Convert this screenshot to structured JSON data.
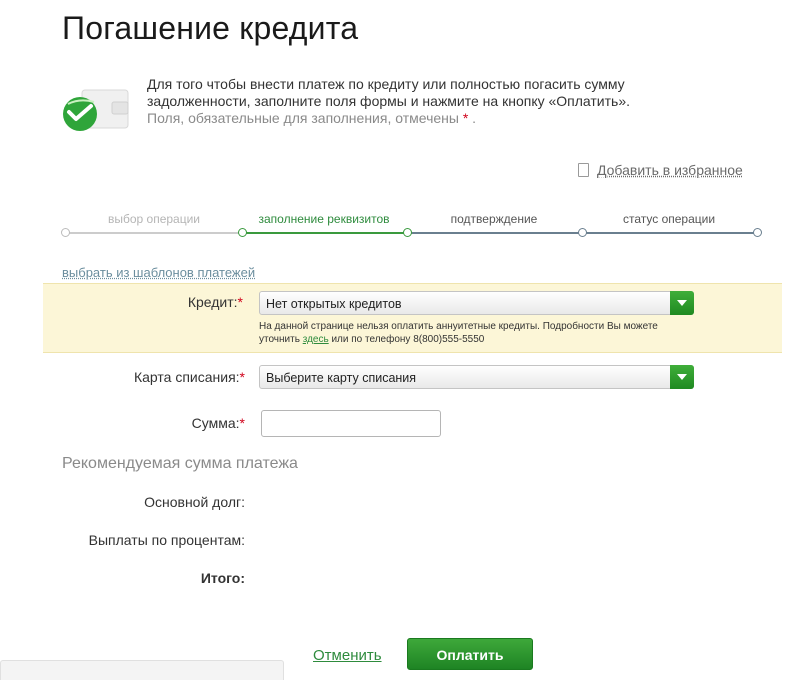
{
  "page": {
    "title": "Погашение кредита"
  },
  "intro": {
    "line1": "Для того чтобы внести платеж по кредиту или полностью погасить сумму",
    "line2": "задолженности, заполните поля формы и нажмите на кнопку «Оплатить».",
    "line3": "Поля, обязательные для заполнения, отмечены",
    "required_mark": "*",
    "line3_end": "."
  },
  "favorites": {
    "label": "Добавить в избранное"
  },
  "steps": [
    {
      "label": "выбор операции",
      "state": "done"
    },
    {
      "label": "заполнение реквизитов",
      "state": "active"
    },
    {
      "label": "подтверждение",
      "state": "next"
    },
    {
      "label": "статус операции",
      "state": "next"
    }
  ],
  "templates": {
    "label": "выбрать из шаблонов платежей"
  },
  "credit": {
    "label": "Кредит:",
    "required_mark": "*",
    "value": "Нет открытых кредитов",
    "note_part1": "На данной странице нельзя оплатить аннуитетные кредиты. Подробности Вы можете",
    "note_part2": "уточнить",
    "note_link": "здесь",
    "note_part3": "или по телефону 8(800)555-5550"
  },
  "card": {
    "label": "Карта списания:",
    "required_mark": "*",
    "value": "Выберите карту списания"
  },
  "amount": {
    "label": "Сумма:",
    "required_mark": "*",
    "value": ""
  },
  "recommended": {
    "title": "Рекомендуемая сумма платежа",
    "principal_label": "Основной долг:",
    "interest_label": "Выплаты по процентам:",
    "total_label": "Итого:"
  },
  "actions": {
    "cancel_label": "Отменить",
    "pay_label": "Оплатить"
  },
  "colors": {
    "accent_green": "#2e8b3d",
    "required_red": "#d0021b",
    "highlight_bg": "#fcf6d7"
  }
}
